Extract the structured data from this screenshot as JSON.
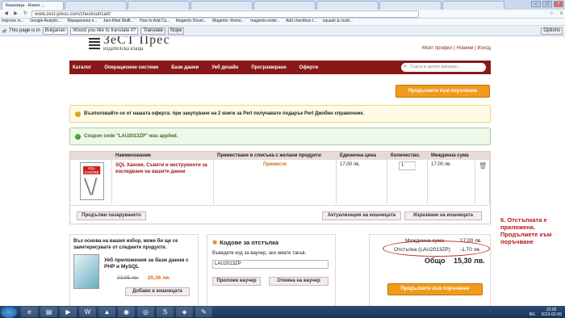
{
  "browser": {
    "tabs": [
      "Кошница - Книги ...",
      "",
      "",
      "",
      "",
      "",
      "",
      ""
    ],
    "url": "www.zest-press.com/checkout/cart/",
    "bookmarks": [
      "Improve m...",
      "Google Analytic...",
      "Макаронени п...",
      "Jam-filled Muffi...",
      "How to Add Cu...",
      "Magento Devel...",
      "Magento: Remo...",
      "magento-order...",
      "Add checkbox t...",
      "squash & ricott..."
    ],
    "translate": {
      "prefix": "This page is in",
      "language": "Bulgarian",
      "question": "Would you like to translate it?",
      "translate_btn": "Translate",
      "nope_btn": "Nope",
      "options_btn": "Options"
    }
  },
  "site": {
    "logo_title": "ЗеСТ Прес",
    "logo_sub": "издателска къща",
    "toplinks": "Моят профил | Новини | Изход",
    "nav": [
      "Каталог",
      "Операционни системи",
      "Бази данни",
      "Уеб дизайн",
      "Програмиране",
      "Оферти"
    ],
    "search_placeholder": "Търси в целия магазин..."
  },
  "cart": {
    "proceed_btn": "Продължете към поръчване",
    "offer_notice": "Възползвайте се от нашата оферта: при закупуване на 2 книги за Perl получавате подарък Perl Джобен справочник.",
    "coupon_notice": "Coupon code \"LAU2013ZP\" was applied.",
    "headers": [
      "Наименование",
      "Преместване в списъка с желани продукти",
      "Единична цена",
      "Количество.",
      "Междинна сума"
    ],
    "item": {
      "name": "SQL Хакове, Съвети и инструменти за изследване на вашите данни",
      "move": "Премести",
      "price": "17,00 лв.",
      "qty": "1",
      "subtotal": "17,00 лв.",
      "cover_text": "SQL ХАКОВЕ"
    },
    "continue_btn": "Продължи пазаруването",
    "update_btn": "Актуализация на кошницата",
    "empty_btn": "Изразване на кошницата"
  },
  "crosssell": {
    "intro": "Въз основа на вашия избор, може би ще се заинтересувате от следните продукти.",
    "name": "Уеб приложения за бази данни с PHP и MySQL",
    "old_price": "23,95 лв.",
    "new_price": "20,36 лв.",
    "add_btn": "Добави в кошницата"
  },
  "coupon": {
    "title": "Кодове за отстъпка",
    "hint": "Въведете код за ваучер, ако имате такъв.",
    "value": "LAU2013ZP",
    "apply_btn": "Приложи ваучер",
    "cancel_btn": "Отмяна на ваучер"
  },
  "totals": {
    "subtotal_label": "Междинна сума",
    "subtotal": "17,00 лв.",
    "discount_label": "Отстъпка (LAU2013ZP)",
    "discount": "-1,70 лв.",
    "total_label": "Общо",
    "total": "15,30 лв.",
    "proceed_btn": "Продължете към поръчване"
  },
  "annotation": "6. Отстъпката е приложена. Продължете към поръчване",
  "taskbar": {
    "lang": "BG",
    "time": "22:02",
    "date": "2013-02-05"
  }
}
